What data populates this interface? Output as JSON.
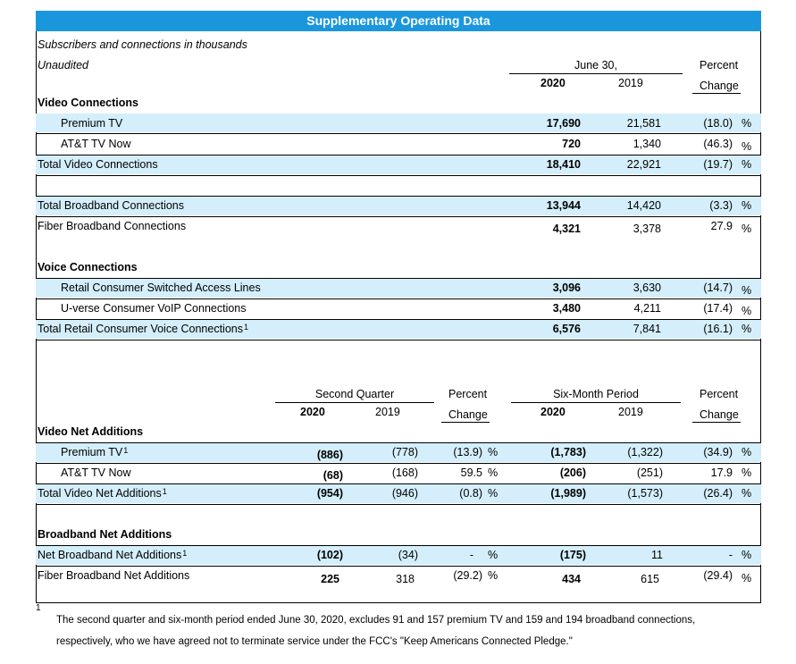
{
  "title": "Supplementary Operating Data",
  "subtitle1": "Subscribers and connections in thousands",
  "subtitle2": "Unaudited",
  "top_header": {
    "period": "June 30,",
    "col_a": "2020",
    "col_b": "2019",
    "pct1": "Percent",
    "pct2": "Change"
  },
  "video": {
    "heading": "Video Connections",
    "premium": {
      "label": "Premium TV",
      "a": "17,690",
      "b": "21,581",
      "pct": "(18.0)",
      "sign": "%"
    },
    "now": {
      "label": "AT&T TV Now",
      "a": "720",
      "b": "1,340",
      "pct": "(46.3)",
      "sign": "%"
    },
    "total": {
      "label": "Total Video Connections",
      "a": "18,410",
      "b": "22,921",
      "pct": "(19.7)",
      "sign": "%"
    }
  },
  "broadband": {
    "total": {
      "label": "Total Broadband Connections",
      "a": "13,944",
      "b": "14,420",
      "pct": "(3.3)",
      "sign": "%"
    },
    "fiber": {
      "label": "Fiber Broadband Connections",
      "a": "4,321",
      "b": "3,378",
      "pct": "27.9",
      "sign": "%"
    }
  },
  "voice": {
    "heading": "Voice Connections",
    "retail": {
      "label": "Retail Consumer Switched Access Lines",
      "a": "3,096",
      "b": "3,630",
      "pct": "(14.7)",
      "sign": "%"
    },
    "voip": {
      "label": "U-verse Consumer VoIP Connections",
      "a": "3,480",
      "b": "4,211",
      "pct": "(17.4)",
      "sign": "%"
    },
    "total": {
      "label": "Total Retail Consumer Voice Connections",
      "sup": "1",
      "a": "6,576",
      "b": "7,841",
      "pct": "(16.1)",
      "sign": "%"
    }
  },
  "bottom_header": {
    "quarter": "Second Quarter",
    "q_a": "2020",
    "q_b": "2019",
    "pct1": "Percent",
    "pct2": "Change",
    "six": "Six-Month Period",
    "s_a": "2020",
    "s_b": "2019",
    "pct3": "Percent",
    "pct4": "Change"
  },
  "video_net": {
    "heading": "Video Net Additions",
    "premium": {
      "label": "Premium TV",
      "sup": "1",
      "qa": "(886)",
      "qb": "(778)",
      "qp": "(13.9)",
      "qs": "%",
      "sa": "(1,783)",
      "sb": "(1,322)",
      "sp": "(34.9)",
      "ss": "%"
    },
    "now": {
      "label": "AT&T TV Now",
      "qa": "(68)",
      "qb": "(168)",
      "qp": "59.5",
      "qs": "%",
      "sa": "(206)",
      "sb": "(251)",
      "sp": "17.9",
      "ss": "%"
    },
    "total": {
      "label": "Total Video Net Additions",
      "sup": "1",
      "qa": "(954)",
      "qb": "(946)",
      "qp": "(0.8)",
      "qs": "%",
      "sa": "(1,989)",
      "sb": "(1,573)",
      "sp": "(26.4)",
      "ss": "%"
    }
  },
  "broadband_net": {
    "heading": "Broadband Net Additions",
    "net": {
      "label": "Net Broadband Net Additions",
      "sup": "1",
      "qa": "(102)",
      "qb": "(34)",
      "qp": "-",
      "qs": "%",
      "sa": "(175)",
      "sb": "11",
      "sp": "-",
      "ss": "%"
    },
    "fiber": {
      "label": "Fiber Broadband Net Additions",
      "qa": "225",
      "qb": "318",
      "qp": "(29.2)",
      "qs": "%",
      "sa": "434",
      "sb": "615",
      "sp": "(29.4)",
      "ss": "%"
    }
  },
  "footnote": {
    "marker": "1",
    "line1": "The second quarter and six-month period ended June 30, 2020, excludes 91 and 157 premium TV  and 159 and 194 broadband connections,",
    "line2": "respectively, who we have agreed not to terminate service under the FCC's \"Keep Americans Connected Pledge.\""
  },
  "colors": {
    "title_bg": "#1a97dc",
    "band": "#d4effb"
  }
}
